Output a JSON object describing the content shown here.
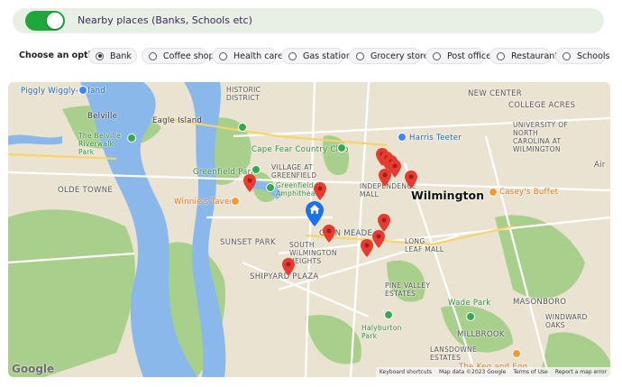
{
  "toggle": {
    "label": "Nearby places (Banks, Schools etc)",
    "enabled": true
  },
  "options": {
    "label": "Choose an option:",
    "items": [
      "Bank",
      "Coffee shop",
      "Health care",
      "Gas station",
      "Grocery store",
      "Post office",
      "Restaurant",
      "Schools"
    ],
    "selected": "Bank"
  },
  "map": {
    "labels": {
      "wiggly": "Piggly Wiggly-Leland",
      "historic": "HISTORIC\nDISTRICT",
      "new_center": "NEW CENTER",
      "college_acres": "COLLEGE ACRES",
      "belville": "Belville",
      "eagle_island": "Eagle Island",
      "harris_teeter": "Harris Teeter",
      "uncw": "UNIVERSITY OF\nNORTH\nCAROLINA AT\nWILMINGTON",
      "riverwalk": "The Belville\nRiverwalk\nPark",
      "cape_fear_cc": "Cape Fear Country Club",
      "village": "VILLAGE AT\nGREENFIELD",
      "greenfield_park": "Greenfield Park",
      "amphitheatre": "Greenfield\nAmphitheatre",
      "independence_mall": "INDEPENDENCE\nMALL",
      "wilmington": "Wilmington",
      "caseys": "Casey's Buffet",
      "olde_towne": "OLDE TOWNE",
      "winnies": "Winnie's Tavern",
      "sunset_park": "SUNSET PARK",
      "glen_meade": "GLEN MEADE",
      "south_wilmington": "SOUTH\nWILMINGTON\nHEIGHTS",
      "long_leaf": "LONG\nLEAF MALL",
      "shipyard": "SHIPYARD PLAZA",
      "pine_valley": "PINE VALLEY\nESTATES",
      "wade_park": "Wade Park",
      "masonboro": "MASONBORO",
      "windward": "WINDWARD\nOAKS",
      "halyburton": "Halyburton\nPark",
      "millbrook": "MILLBROOK",
      "lansdowne": "LANSDOWNE\nESTATES",
      "keg": "The Keg and Egg",
      "air": "Air"
    },
    "google": "Google",
    "attribution": [
      "Keyboard shortcuts",
      "Map data ©2023 Google",
      "Terms of Use",
      "Report a map error"
    ],
    "colors": {
      "land": "#ebe3d1",
      "water": "#8ab8ea",
      "park": "#a9cf8c",
      "pin": "#e53b30",
      "home_pin": "#1a73e8",
      "toggle_on": "#1fa63d"
    }
  }
}
